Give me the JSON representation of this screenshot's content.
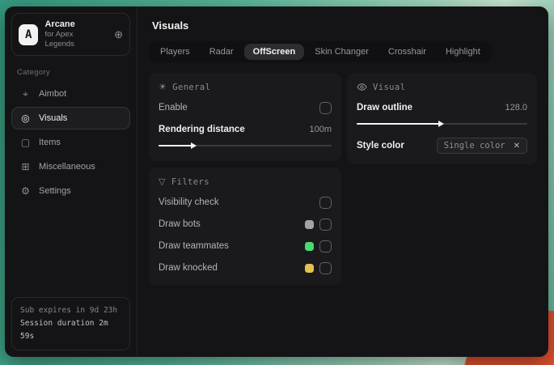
{
  "colors": {
    "accent_gray": "#a3a3a3",
    "accent_green": "#4cd970",
    "accent_yellow": "#e3c14f"
  },
  "sidebar": {
    "logo_letter": "A",
    "app_name": "Arcane",
    "app_subtitle": "for Apex Legends",
    "pin_icon": "⊕",
    "category_label": "Category",
    "items": [
      {
        "label": "Aimbot",
        "icon": "⌖"
      },
      {
        "label": "Visuals",
        "icon": "◎"
      },
      {
        "label": "Items",
        "icon": "▢"
      },
      {
        "label": "Miscellaneous",
        "icon": "⊞"
      },
      {
        "label": "Settings",
        "icon": "⚙"
      }
    ],
    "status": {
      "line1": "Sub expires in 9d 23h",
      "line2": "Session duration 2m 59s"
    }
  },
  "main": {
    "title": "Visuals",
    "tabs": [
      {
        "label": "Players"
      },
      {
        "label": "Radar"
      },
      {
        "label": "OffScreen"
      },
      {
        "label": "Skin Changer"
      },
      {
        "label": "Crosshair"
      },
      {
        "label": "Highlight"
      }
    ],
    "general": {
      "icon": "☀",
      "title": "General",
      "enable_label": "Enable",
      "rendering_label": "Rendering distance",
      "rendering_value": "100m",
      "rendering_percent": 21
    },
    "filters": {
      "icon": "▽",
      "title": "Filters",
      "rows": [
        {
          "label": "Visibility check",
          "swatch": ""
        },
        {
          "label": "Draw bots",
          "swatch": "#a3a3a3"
        },
        {
          "label": "Draw teammates",
          "swatch": "#4cd970"
        },
        {
          "label": "Draw knocked",
          "swatch": "#e3c14f"
        }
      ]
    },
    "visual": {
      "title": "Visual",
      "outline_label": "Draw outline",
      "outline_value": "128.0",
      "outline_percent": 50,
      "style_label": "Style color",
      "style_value": "Single color",
      "style_remove": "✕"
    }
  }
}
